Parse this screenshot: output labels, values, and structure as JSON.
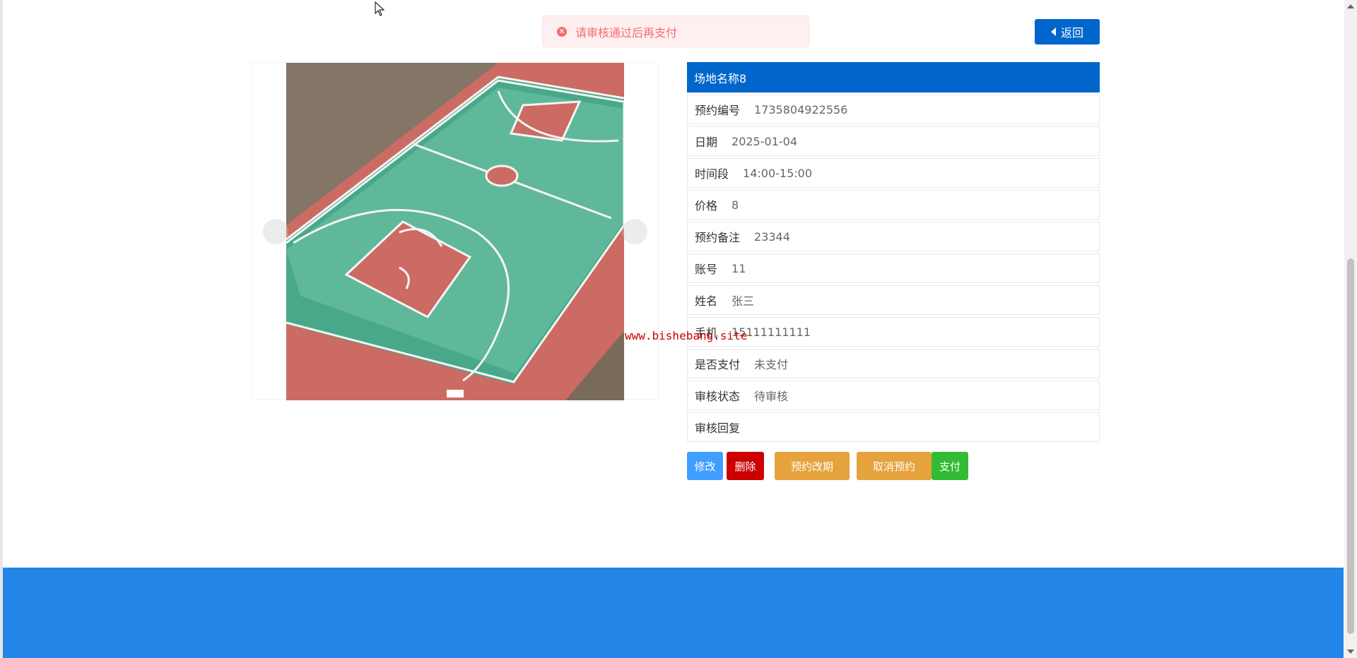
{
  "toast": {
    "message": "请审核通过后再支付",
    "icon": "close-circle-icon"
  },
  "header": {
    "back_label": "返回",
    "back_icon": "caret-left-icon"
  },
  "carousel": {
    "image_desc_icon": "basketball-court-image"
  },
  "detail": {
    "title": "场地名称8",
    "rows": [
      {
        "label": "预约编号",
        "value": "1735804922556"
      },
      {
        "label": "日期",
        "value": "2025-01-04"
      },
      {
        "label": "时间段",
        "value": "14:00-15:00"
      },
      {
        "label": "价格",
        "value": "8"
      },
      {
        "label": "预约备注",
        "value": "23344"
      },
      {
        "label": "账号",
        "value": "11"
      },
      {
        "label": "姓名",
        "value": "张三"
      },
      {
        "label": "手机",
        "value": "15111111111"
      },
      {
        "label": "是否支付",
        "value": "未支付"
      },
      {
        "label": "审核状态",
        "value": "待审核"
      },
      {
        "label": "审核回复",
        "value": ""
      }
    ]
  },
  "actions": {
    "edit": "修改",
    "delete": "删除",
    "reschedule": "预约改期",
    "cancel": "取消预约",
    "pay": "支付"
  },
  "watermark": "www.bishebang.site",
  "colors": {
    "primary": "#0066cc",
    "footer": "#2385e8",
    "edit": "#409eff",
    "delete": "#cc0000",
    "warning": "#e6a23c",
    "success": "#33bb33",
    "error": "#f56c6c"
  }
}
